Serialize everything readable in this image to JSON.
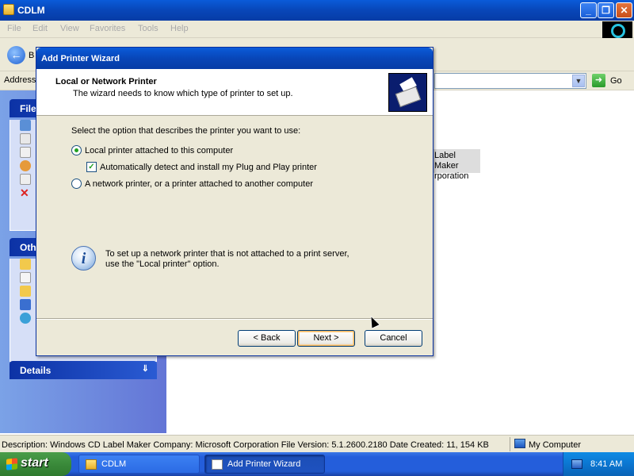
{
  "window": {
    "title": "CDLM",
    "controls": {
      "minimize": "_",
      "maximize": "❐",
      "close": "✕"
    }
  },
  "menu": [
    "File",
    "Edit",
    "View",
    "Favorites",
    "Tools",
    "Help"
  ],
  "toolbar": {
    "back_label": "B"
  },
  "addressbar": {
    "label": "Address",
    "go_label": "Go"
  },
  "leftpane": {
    "panel1_title": "File",
    "panel2_title": "Oth",
    "panel3_title": "Details"
  },
  "list_item": {
    "line1": "Label Maker",
    "line2": "rporation"
  },
  "statusbar": {
    "description": "Description: Windows CD Label Maker Company: Microsoft Corporation File Version: 5.1.2600.2180 Date Created: 11, 154 KB",
    "location": "My Computer"
  },
  "taskbar": {
    "start_label": "start",
    "tasks": [
      {
        "label": "CDLM",
        "active": false
      },
      {
        "label": "Add Printer Wizard",
        "active": true
      }
    ],
    "clock": "8:41 AM"
  },
  "dialog": {
    "title": "Add Printer Wizard",
    "header_title": "Local or Network Printer",
    "header_subtitle": "The wizard needs to know which type of printer to set up.",
    "prompt": "Select the option that describes the printer you want to use:",
    "options": [
      {
        "label": "Local printer attached to this computer",
        "selected": true
      },
      {
        "label": "A network printer, or a printer attached to another computer",
        "selected": false
      }
    ],
    "checkbox": {
      "label": "Automatically detect and install my Plug and Play printer",
      "checked": true
    },
    "info_line1": "To set up a network printer that is not attached to a print server,",
    "info_line2": "use the \"Local printer\" option.",
    "buttons": {
      "back": "< Back",
      "next": "Next >",
      "cancel": "Cancel"
    }
  },
  "colors": {
    "titlebar": "#0846b8",
    "taskbar": "#245edb",
    "start_green": "#3a8a3a",
    "dialog_face": "#ece9d8",
    "default_button_glow": "#f5b95f"
  }
}
